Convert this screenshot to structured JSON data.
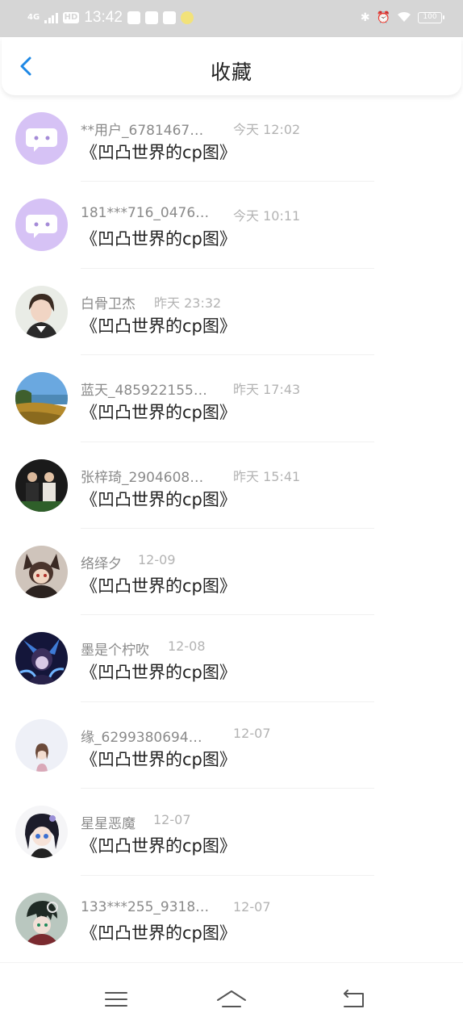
{
  "status_bar": {
    "network": "4G",
    "hd": "HD",
    "time": "13:42",
    "battery": "100"
  },
  "header": {
    "title": "收藏",
    "back_icon": "chevron-left-icon"
  },
  "colors": {
    "accent": "#1e88e5",
    "placeholder_avatar": "#d6c2f5"
  },
  "items": [
    {
      "name": "**用户_6781467…",
      "time": "今天 12:02",
      "title": "《凹凸世界的cp图》"
    },
    {
      "name": "181***716_0476…",
      "time": "今天 10:11",
      "title": "《凹凸世界的cp图》"
    },
    {
      "name": "白骨卫杰",
      "time": "昨天 23:32",
      "title": "《凹凸世界的cp图》"
    },
    {
      "name": "蓝天_485922155…",
      "time": "昨天 17:43",
      "title": "《凹凸世界的cp图》"
    },
    {
      "name": "张梓琦_2904608…",
      "time": "昨天 15:41",
      "title": "《凹凸世界的cp图》"
    },
    {
      "name": "络绎夕",
      "time": "12-09",
      "title": "《凹凸世界的cp图》"
    },
    {
      "name": "墨是个柠吹",
      "time": "12-08",
      "title": "《凹凸世界的cp图》"
    },
    {
      "name": "缘_6299380694…",
      "time": "12-07",
      "title": "《凹凸世界的cp图》"
    },
    {
      "name": "星星恶魔",
      "time": "12-07",
      "title": "《凹凸世界的cp图》"
    },
    {
      "name": "133***255_9318…",
      "time": "12-07",
      "title": "《凹凸世界的cp图》"
    }
  ],
  "nav_bar": {
    "menu_icon": "menu-icon",
    "home_icon": "home-icon",
    "back_icon": "back-icon"
  }
}
